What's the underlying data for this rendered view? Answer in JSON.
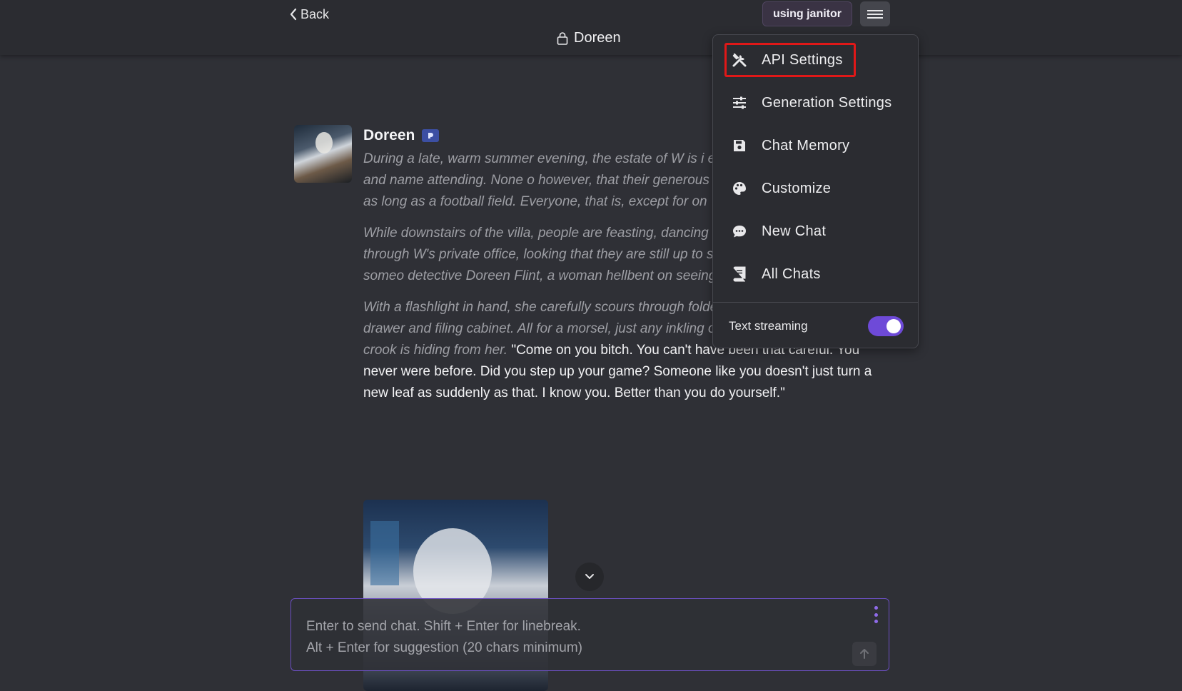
{
  "header": {
    "back_label": "Back",
    "title": "Doreen",
    "using_label": "using janitor"
  },
  "character": {
    "name": "Doreen",
    "badge_icon": "verified-badge-icon"
  },
  "message": {
    "p1": "During a late, warm summer evening, the estate of W is i event with everyone of rank and name attending. None o however, that their generous host is actually a notorious as long as a football field. Everyone, that is, except for on",
    "p2": "While downstairs of the villa, people are feasting, dancing upstairs is rummaging through W's private office, looking that they are still up to some shady shit. And that someo detective Doreen Flint, a woman hellbent on seeing this p bars.",
    "p3_narration": "With a flashlight in hand, she carefully scours through folder after folder, opens every drawer and filing cabinet. All for a morsel, just any inkling of criminal activity that this crook is hiding from her.",
    "p3_speech": "\"Come on you bitch. You can't have been that careful. You never were before. Did you step up your game? Someone like you doesn't just turn a new leaf as suddenly as that. I know you. Better than you do yourself.\""
  },
  "chat_input": {
    "placeholder": "Enter to send chat. Shift + Enter for linebreak.\nAlt + Enter for suggestion (20 chars minimum)"
  },
  "menu": {
    "items": [
      {
        "label": "API Settings",
        "icon": "tools-icon"
      },
      {
        "label": "Generation Settings",
        "icon": "sliders-icon"
      },
      {
        "label": "Chat Memory",
        "icon": "save-icon"
      },
      {
        "label": "Customize",
        "icon": "palette-icon"
      },
      {
        "label": "New Chat",
        "icon": "chat-bubble-icon"
      },
      {
        "label": "All Chats",
        "icon": "book-icon"
      }
    ],
    "text_streaming_label": "Text streaming",
    "text_streaming_enabled": true
  },
  "colors": {
    "accent": "#6e4ad8",
    "highlight_border": "#e01818",
    "background": "#2f3036"
  }
}
